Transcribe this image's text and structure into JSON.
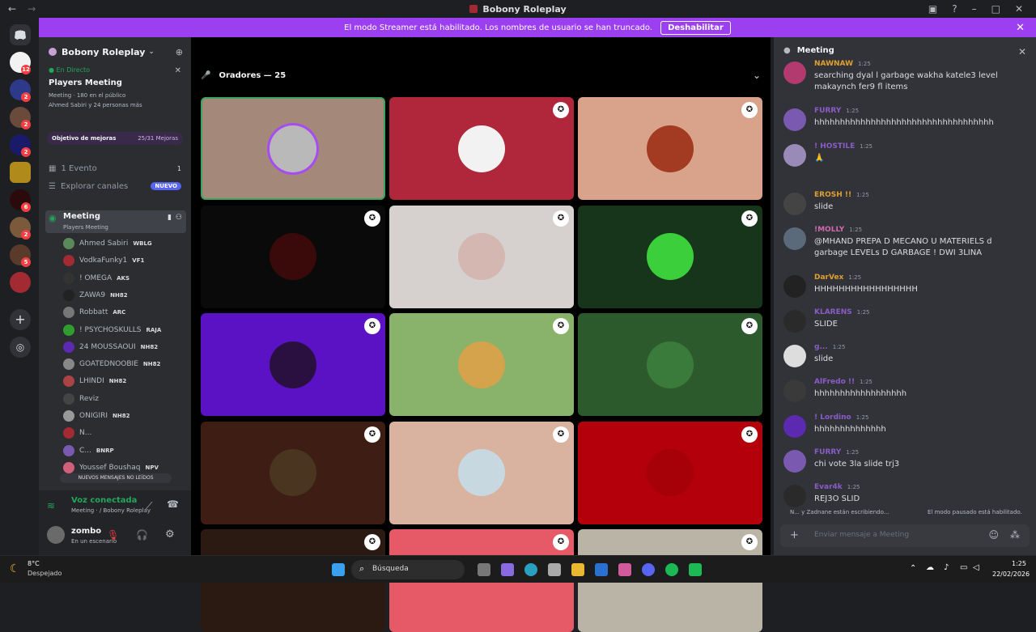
{
  "window": {
    "title": "Bobony Roleplay"
  },
  "banner": {
    "text": "El modo Streamer está habilitado. Los nombres de usuario se han truncado.",
    "button": "Deshabilitar"
  },
  "rail_badges": [
    "12",
    "2",
    "2",
    "2",
    "6",
    "2",
    "5"
  ],
  "sidebar": {
    "server_name": "Bobony Roleplay",
    "live_label": "En Directo",
    "live_title": "Players Meeting",
    "live_meta": "Meeting · 180 en el público",
    "live_meta2": "Ahmed Sabiri y 24 personas más",
    "boost_label": "Objetivo de mejoras",
    "boost_value": "25/31 Mejoras",
    "event_label": "1 Evento",
    "event_count": "1",
    "explore_label": "Explorar canales",
    "explore_badge": "NUEVO",
    "channel_name": "Meeting",
    "channel_sub": "Players Meeting",
    "members": [
      {
        "name": "Ahmed Sabiri",
        "tag": "WBLG",
        "color": "#5a8a5a"
      },
      {
        "name": "VodkaFunky1",
        "tag": "VF1",
        "color": "#a12a33"
      },
      {
        "name": "! OMEGA",
        "tag": "AKS",
        "color": "#333"
      },
      {
        "name": "ZAWA9",
        "tag": "NH82",
        "color": "#222"
      },
      {
        "name": "Robbatt",
        "tag": "ARC",
        "color": "#777"
      },
      {
        "name": "! PSYCHOSKULLS",
        "tag": "RAJA",
        "color": "#2f9e2f"
      },
      {
        "name": "24 MOUSSAOUI",
        "tag": "NH82",
        "color": "#5c2ab0"
      },
      {
        "name": "GOATEDNOOBIE",
        "tag": "NH82",
        "color": "#888"
      },
      {
        "name": "LHINDI",
        "tag": "NH82",
        "color": "#aa4444"
      },
      {
        "name": "Reviz",
        "tag": "",
        "color": "#444"
      },
      {
        "name": "ONIGIRI",
        "tag": "NH82",
        "color": "#999"
      },
      {
        "name": "N...",
        "tag": "",
        "color": "#a12a33"
      },
      {
        "name": "C...",
        "tag": "BNRP",
        "color": "#7a5ab0"
      },
      {
        "name": "Youssef Boushaq",
        "tag": "NPV",
        "color": "#d0607a"
      }
    ],
    "unread_pill": "NUEVOS MENSAJES NO LEÍDOS",
    "voice_status": "Voz conectada",
    "voice_location": "Meeting · / Bobony Roleplay",
    "user_name": "zombo",
    "user_status": "En un escenario"
  },
  "stage": {
    "header": "Oradores — 25",
    "tiles": [
      {
        "bg": "#a4897b",
        "pic": "#b9b9b9",
        "ring": true
      },
      {
        "bg": "#b0263a",
        "pic": "#f2f2f2"
      },
      {
        "bg": "#d9a28a",
        "pic": "#a33a22"
      },
      {
        "bg": "#0a0a0a",
        "pic": "#3a0a0a"
      },
      {
        "bg": "#d6d0cf",
        "pic": "#d3b7b0"
      },
      {
        "bg": "#17351a",
        "pic": "#3ccf3c"
      },
      {
        "bg": "#5b12c4",
        "pic": "#2a1040"
      },
      {
        "bg": "#89b36a",
        "pic": "#d4a34b"
      },
      {
        "bg": "#2d5a2d",
        "pic": "#3a7a3a"
      },
      {
        "bg": "#3d1d14",
        "pic": "#4a3620"
      },
      {
        "bg": "#d9b39f",
        "pic": "#c8d8e0"
      },
      {
        "bg": "#b3000a",
        "pic": "#a60008"
      },
      {
        "bg": "#2b1a12",
        "pic": "#2b1a12"
      },
      {
        "bg": "#e55a66",
        "pic": "#e55a66"
      },
      {
        "bg": "#b9b4a6",
        "pic": "#b9b4a6"
      }
    ]
  },
  "chat": {
    "title": "Meeting",
    "messages": [
      {
        "name": "NAWNAW",
        "color": "#e0a030",
        "time": "1:25",
        "text": "searching dyal l garbage wakha katele3 level makaynch fer9 fl items",
        "av": "#b23a6e"
      },
      {
        "name": "FURRY",
        "color": "#8a5cc8",
        "time": "1:25",
        "text": "hhhhhhhhhhhhhhhhhhhhhhhhhhhhhhhhhhh",
        "av": "#7a5ab0"
      },
      {
        "name": "! HOSTILE",
        "color": "#8a5cc8",
        "time": "1:25",
        "text": "🙏",
        "av": "#9a8ab8"
      },
      {
        "name": "EROSH !!",
        "color": "#e0a030",
        "time": "1:25",
        "text": "slide",
        "av": "#444"
      },
      {
        "name": "!MOLLY",
        "color": "#d06ab0",
        "time": "1:25",
        "text": "@MHAND PREPA D MECANO U MATERIELS d garbage LEVELs D GARBAGE ! DWI 3LINA",
        "av": "#5a6a7a"
      },
      {
        "name": "DarVex",
        "color": "#e0a030",
        "time": "1:25",
        "text": "HHHHHHHHHHHHHHHHH",
        "av": "#222"
      },
      {
        "name": "KLARENS",
        "color": "#8a5cc8",
        "time": "1:25",
        "text": "SLIDE",
        "av": "#2a2a2a"
      },
      {
        "name": "g...",
        "color": "#8a5cc8",
        "time": "1:25",
        "text": "slide",
        "av": "#ddd"
      },
      {
        "name": "AlFredo !!",
        "color": "#8a5cc8",
        "time": "1:25",
        "text": "hhhhhhhhhhhhhhhhhh",
        "av": "#3a3a3a"
      },
      {
        "name": "! Lordino",
        "color": "#8a5cc8",
        "time": "1:25",
        "text": "hhhhhhhhhhhhhh",
        "av": "#5c2ab0"
      },
      {
        "name": "FURRY",
        "color": "#8a5cc8",
        "time": "1:25",
        "text": "chi vote 3la slide trj3",
        "av": "#7a5ab0"
      },
      {
        "name": "Evar4k",
        "color": "#8a5cc8",
        "time": "1:25",
        "text": "REJ3O SLID",
        "av": "#2a2a2a"
      }
    ],
    "typing": "N... y Zadnane están escribiendo...",
    "paused": "El modo pausado está habilitado.",
    "input_placeholder": "Enviar mensaje a Meeting"
  },
  "taskbar": {
    "weather_temp": "8°C",
    "weather_desc": "Despejado",
    "search": "Búsqueda",
    "time": "1:25",
    "date": "22/02/2026"
  },
  "colors": {
    "accent": "#9b3ff0",
    "live": "#23a55a",
    "blurple": "#5865f2"
  }
}
